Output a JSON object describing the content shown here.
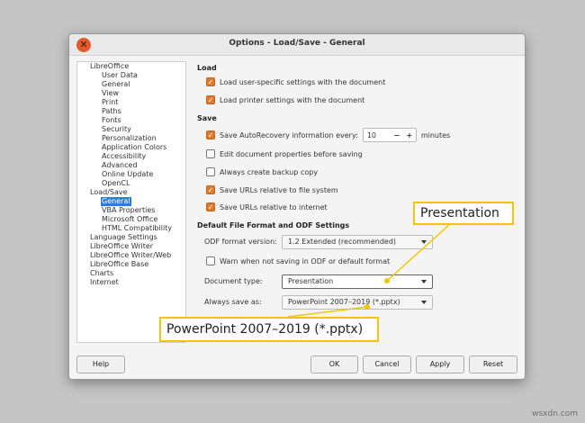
{
  "window": {
    "title": "Options - Load/Save - General",
    "close_glyph": "✕"
  },
  "tree": {
    "items": [
      "LibreOffice",
      "User Data",
      "General",
      "View",
      "Print",
      "Paths",
      "Fonts",
      "Security",
      "Personalization",
      "Application Colors",
      "Accessibility",
      "Advanced",
      "Online Update",
      "OpenCL",
      "Load/Save",
      "General",
      "VBA Properties",
      "Microsoft Office",
      "HTML Compatibility",
      "Language Settings",
      "LibreOffice Writer",
      "LibreOffice Writer/Web",
      "LibreOffice Base",
      "Charts",
      "Internet"
    ]
  },
  "load": {
    "heading": "Load",
    "user_settings": {
      "label": "Load user-specific settings with the document",
      "checked": true
    },
    "printer_settings": {
      "label": "Load printer settings with the document",
      "checked": true
    }
  },
  "save": {
    "heading": "Save",
    "autorecovery": {
      "label": "Save AutoRecovery information every:",
      "checked": true,
      "value": "10",
      "minus": "−",
      "plus": "+",
      "unit": "minutes"
    },
    "edit_props": {
      "label": "Edit document properties before saving",
      "checked": false
    },
    "backup": {
      "label": "Always create backup copy",
      "checked": false
    },
    "urls_fs": {
      "label": "Save URLs relative to file system",
      "checked": true
    },
    "urls_internet": {
      "label": "Save URLs relative to internet",
      "checked": true
    }
  },
  "format": {
    "heading": "Default File Format and ODF Settings",
    "odf_label": "ODF format version:",
    "odf_value": "1.2 Extended (recommended)",
    "warn": {
      "label": "Warn when not saving in ODF or default format",
      "checked": false
    },
    "doctype_label": "Document type:",
    "doctype_value": "Presentation",
    "saveas_label": "Always save as:",
    "saveas_value": "PowerPoint 2007–2019 (*.pptx)"
  },
  "buttons": {
    "help": "Help",
    "ok": "OK",
    "cancel": "Cancel",
    "apply": "Apply",
    "reset": "Reset"
  },
  "callouts": {
    "top": "Presentation",
    "bottom": "PowerPoint 2007–2019 (*.pptx)"
  },
  "watermark": "wsxdn.com",
  "colors": {
    "accent": "#e07a2a",
    "selection": "#2a7fd4",
    "callout_border": "#f2c40b"
  }
}
